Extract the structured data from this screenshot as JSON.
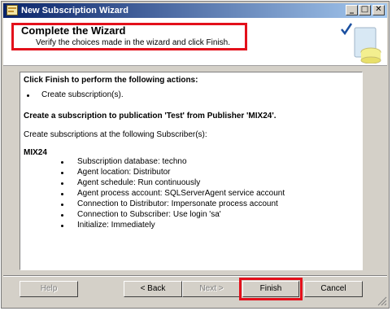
{
  "window": {
    "title": "New Subscription Wizard",
    "buttons": {
      "minimize": "_",
      "maximize": "□",
      "close": "✕"
    }
  },
  "header": {
    "title": "Complete the Wizard",
    "subtitle": "Verify the choices made in the wizard and click Finish."
  },
  "content": {
    "actions_heading": "Click Finish to perform the following actions:",
    "action_items": [
      "Create subscription(s)."
    ],
    "publication_line": "Create a subscription to publication 'Test' from Publisher 'MIX24'.",
    "subscriber_intro": "Create subscriptions at the following Subscriber(s):",
    "subscriber_name": "MIX24",
    "details": [
      "Subscription database: techno",
      "Agent location: Distributor",
      "Agent schedule: Run continuously",
      "Agent process account: SQLServerAgent service account",
      "Connection to Distributor: Impersonate process account",
      "Connection to Subscriber: Use login 'sa'",
      "Initialize: Immediately"
    ]
  },
  "footer": {
    "help_label": "Help",
    "back_label": "< Back",
    "next_label": "Next >",
    "finish_label": "Finish",
    "cancel_label": "Cancel"
  },
  "colors": {
    "highlight": "#e3101b",
    "titlebar_start": "#0a246a",
    "titlebar_end": "#a6caf0"
  },
  "icons": [
    "wizard-app-icon",
    "checkmark-icon",
    "database-icon",
    "resize-grip-icon"
  ]
}
